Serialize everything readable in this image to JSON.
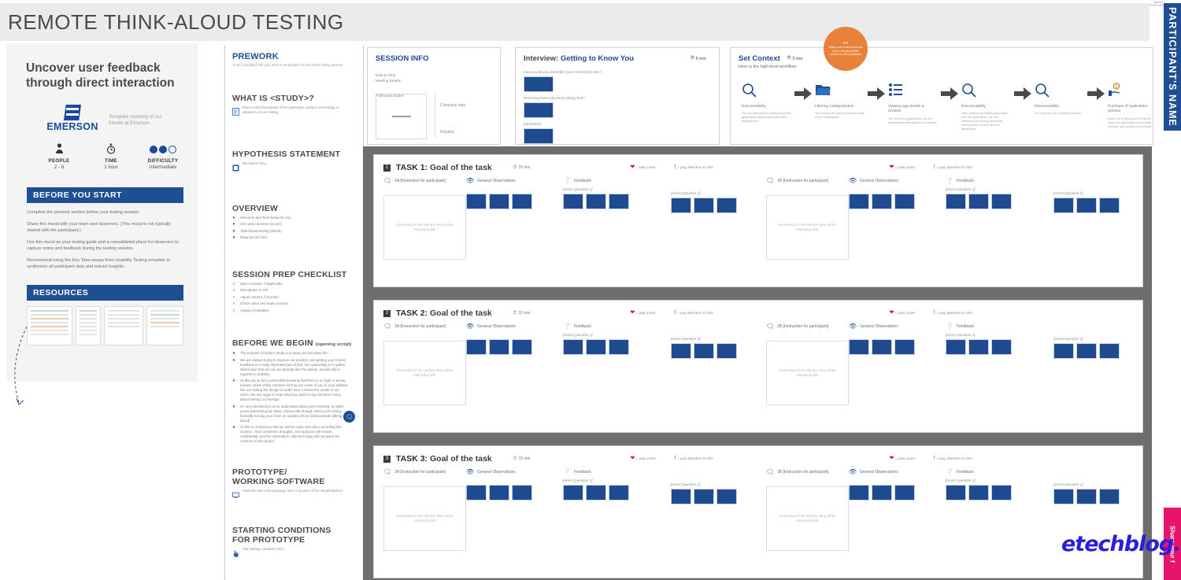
{
  "title": "REMOTE THINK-ALOUD TESTING",
  "left_panel": {
    "headline_line1": "Uncover user feedback",
    "headline_line2": "through direct interaction",
    "brand_name": "EMERSON",
    "brand_courtesy": "Template courtesy of our friends at Emerson",
    "meta": [
      {
        "icon": "person-icon",
        "glyph": "♟",
        "label": "PEOPLE",
        "value": "2 - 8"
      },
      {
        "icon": "stopwatch-icon",
        "glyph": "⏱",
        "label": "TIME",
        "value": "1 hour"
      },
      {
        "icon": "difficulty-dots-icon",
        "glyph": "",
        "label": "DIFFICULTY",
        "value": "Intermediate",
        "filled": 2,
        "total": 3
      }
    ],
    "before_you_start": {
      "heading": "BEFORE YOU START",
      "paragraphs": [
        "Complete the prework section before your testing session.",
        "Share this mural with your team and observers.  (This mural is not typically shared with the participant.)",
        "Use this mural as your testing guide and a consolidated place for observers to capture notes and feedback during the testing session.",
        "Recommend using the Key Take-aways from Usability Testing template to synthesize all participant data and extract insights."
      ]
    },
    "resources": {
      "heading": "RESOURCES"
    }
  },
  "prework": {
    "title": "PREWORK",
    "subtitle": "To be completed with your team in preparation for the useful testing session",
    "sections": [
      {
        "heading": "WHAT IS <STUDY>?",
        "note_icon": "document-icon",
        "note": "Enter a short description of the application, product, technology, or whatever you are testing"
      },
      {
        "heading": "HYPOTHESIS STATEMENT",
        "note_icon": "sticky-note-icon",
        "note": "We believe that..."
      },
      {
        "heading": "OVERVIEW",
        "bullets": [
          "Welcome and Tech Setup (5 min)",
          "Intro and interview (10 min)",
          "Task-based testing (30min)",
          "Wrap-up (15 min)"
        ]
      },
      {
        "heading": "SESSION PREP CHECKLIST",
        "checklist": [
          "Open recorder, if applicable",
          "Microphone is ON",
          "Adjust camera, if needed",
          "Check video and audio sources",
          "Assign a notetaker"
        ]
      }
    ],
    "before_we_begin": {
      "heading": "BEFORE WE BEGIN",
      "sub": "(opening script)",
      "bullets": [
        "The purpose of today's study is to have you test drive the...",
        "We are always trying to improve our product, and getting your honest feedback is a really important part of that.  Our goal today is to gather information that we can incorporate into the design, specifically in regards to usability.",
        "I'd like you to feel comfortable knowing that there is no right or wrong answer. None of the activities we'll do are a test of you or your abilities. We are testing the design to make sure it meets the needs of our users.  We are eager to hear what you have to say and don't worry about hurting our feelings.",
        "It's very beneficial to us to understand what you're thinking, so while you're performing the tasks, please talk through what you're doing, basically turning your brain on speaker phone [demonstrate talking aloud]",
        "I'd like to remind you that we will be audio and video recording this session. Your comments, thoughts, and opinions will remain confidential, and the information collected today will not leave the confines of this project."
      ]
    },
    "prototype": {
      "heading_line1": "PROTOTYPE/",
      "heading_line2": "WORKING SOFTWARE",
      "note_icon": "monitor-icon",
      "note": "Paste the link to the prototype here or location of the Virtual Machine"
    },
    "starting_conditions": {
      "heading_line1": "STARTING CONDITIONS",
      "heading_line2": "FOR PROTOTYPE",
      "note_icon": "hand-pointer-icon",
      "note": "Add starting conditions here"
    }
  },
  "session_info": {
    "title": "SESSION INFO",
    "fields": [
      "Date & Time:",
      "Meeting Details:"
    ],
    "participant_label": "Participant Name",
    "company_logo_label": "Company logo",
    "industry_label": "Industry:"
  },
  "interview": {
    "title_prefix": "Interview:",
    "title_main": "Getting to Know You",
    "duration": "5 min",
    "questions": [
      "How would you describe your current job role?",
      "How long have you been doing that?",
      "[Question]"
    ]
  },
  "set_context": {
    "title": "Set Context",
    "duration": "5 min",
    "subtitle": "Here is the high-level workflow:",
    "steps": [
      {
        "icon": "magnifier-icon",
        "glyph": "🔍",
        "title": "Discoverability",
        "desc": "You are interested in discovering new applications associated with Alarm Management"
      },
      {
        "icon": "folder-icon",
        "glyph": "📁",
        "title": "Filtering Categorization",
        "desc": "You browse the list of products inside of the Marketplace"
      },
      {
        "icon": "list-icon",
        "glyph": "☰",
        "title": "Viewing app details & reviews",
        "desc": "You select an application, see the application's description and reviews"
      },
      {
        "icon": "magnifier-icon",
        "glyph": "🔍",
        "title": "Discoverability",
        "desc": "After reading the details associated with the application, you are interested in learning about the services that complement the application"
      },
      {
        "icon": "magnifier-icon",
        "glyph": "🔍",
        "title": "Discoverability",
        "desc": "You view the list of related services"
      },
      {
        "icon": "purchase-hand-icon",
        "glyph": "💰",
        "title": "Purchase of Application Service",
        "desc": "Based off of what you've learned about the application and related services, you decide to purchase"
      }
    ],
    "arrow_glyph": "➡"
  },
  "tip_badge": {
    "word": "TIP",
    "copy": "Share your screen and use this to visually set the context for the participant"
  },
  "legend": {
    "pain_point_icon": "heart-icon",
    "pain_point": "= pain point",
    "attention_icon": "exclamation-icon",
    "attention": "= pay attention to this"
  },
  "task_labels": {
    "goal": "Goal of the task",
    "duration": "10 min",
    "instruction_icon": "speech-bubble-icon",
    "observations_icon": "eye-icon",
    "observations": "General Observations",
    "feedback_icon": "question-circle-icon",
    "feedback": "Feedback",
    "question1": "[Insert Question 1]",
    "question2": "[Insert Question 2]",
    "screenshot_placeholder": "Screenshot of the interface they will be interacting with"
  },
  "tasks": [
    {
      "num": "1",
      "name": "TASK 1:",
      "left_instruction": "1A [Instruction for participant]",
      "right_instruction": "1B [Instruction for participant]"
    },
    {
      "num": "2",
      "name": "TASK 2:",
      "left_instruction": "2A [Instruction for participant]",
      "right_instruction": "2B [Instruction for participant]"
    },
    {
      "num": "3",
      "name": "TASK 3:",
      "left_instruction": "3A [Instruction for participant]",
      "right_instruction": "3B [Instruction for participant]"
    }
  ],
  "side_tabs": {
    "participant": "PARTICIPANT'S NAME",
    "share": "Share your f"
  },
  "watermark": "etechblog.cz",
  "corner_logo": "MURAL\nTEMPLATE",
  "colors": {
    "brand_blue": "#1f4e93",
    "sticky_blue": "#1e4b8f",
    "pink": "#e6156b",
    "orange": "#e8813a",
    "board_gray": "#6e6e6e",
    "pain_red": "#cc2026"
  }
}
